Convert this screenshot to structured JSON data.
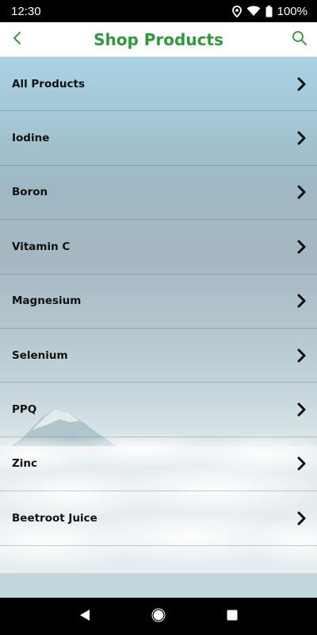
{
  "status_bar": {
    "time": "12:30",
    "battery": "100%",
    "icons": [
      "location-icon",
      "wifi-icon",
      "battery-icon"
    ]
  },
  "header": {
    "title": "Shop Products",
    "back_icon": "chevron-left-icon",
    "search_icon": "search-icon",
    "accent_color": "#2e9a3a"
  },
  "categories": [
    {
      "label": "All Products"
    },
    {
      "label": "Iodine"
    },
    {
      "label": "Boron"
    },
    {
      "label": "Vitamin C"
    },
    {
      "label": "Magnesium"
    },
    {
      "label": "Selenium"
    },
    {
      "label": "PPQ"
    },
    {
      "label": "Zinc"
    },
    {
      "label": "Beetroot Juice"
    }
  ],
  "nav_bar": {
    "icons": [
      "back-triangle-icon",
      "home-circle-icon",
      "recents-square-icon"
    ]
  }
}
